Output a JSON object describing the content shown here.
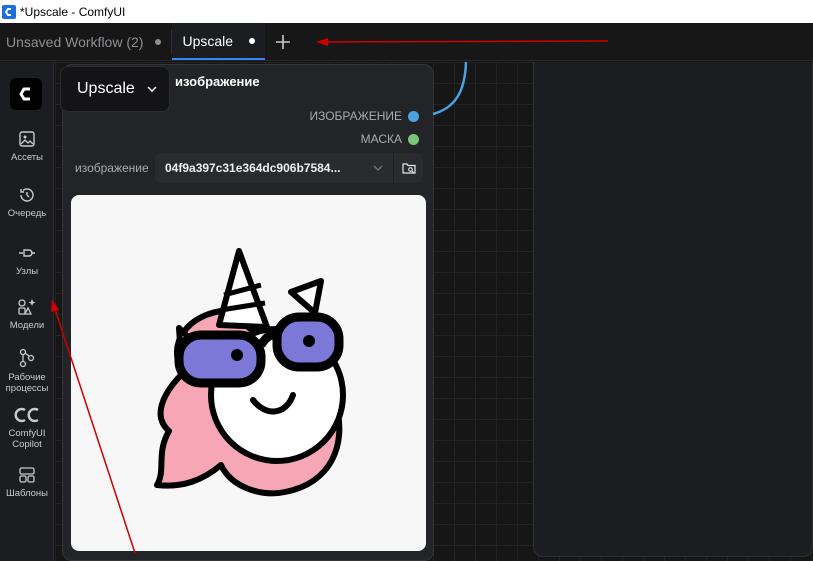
{
  "window": {
    "title": "*Upscale - ComfyUI"
  },
  "tabs": [
    {
      "label": "Unsaved Workflow (2)",
      "active": false
    },
    {
      "label": "Upscale",
      "active": true
    }
  ],
  "sidebar": {
    "items": [
      {
        "label": "Ассеты",
        "icon": "image-icon"
      },
      {
        "label": "Очередь",
        "icon": "history-icon"
      },
      {
        "label": "Узлы",
        "icon": "plug-icon"
      },
      {
        "label": "Модели",
        "icon": "models-icon"
      },
      {
        "label": "Рабочие процессы",
        "icon": "workflow-icon"
      },
      {
        "label": "ComfyUI Copilot",
        "icon": "copilot-icon"
      },
      {
        "label": "Шаблоны",
        "icon": "templates-icon"
      }
    ]
  },
  "workflow_menu": {
    "label": "Upscale"
  },
  "node": {
    "title": "изображение",
    "outputs": [
      {
        "label": "ИЗОБРАЖЕНИЕ",
        "color": "#4aa3df"
      },
      {
        "label": "МАСКА",
        "color": "#7dc57a"
      }
    ],
    "widget": {
      "label": "изображение",
      "value": "04f9a397c31e364dc906b7584..."
    }
  },
  "colors": {
    "accent": "#3b82f6",
    "annotation": "#cc0000"
  }
}
